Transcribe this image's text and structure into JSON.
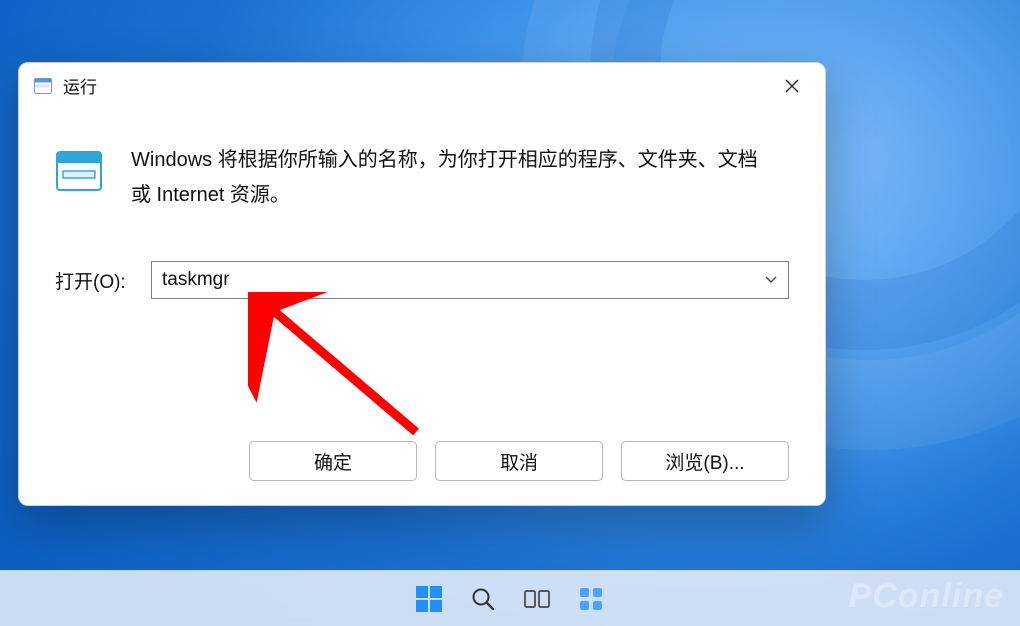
{
  "dialog": {
    "title": "运行",
    "description": "Windows 将根据你所输入的名称，为你打开相应的程序、文件夹、文档或 Internet 资源。",
    "open_label": "打开(O):",
    "input_value": "taskmgr",
    "buttons": {
      "ok": "确定",
      "cancel": "取消",
      "browse": "浏览(B)..."
    }
  },
  "icons": {
    "title_icon": "run-icon",
    "body_icon": "run-icon-large",
    "close": "close-icon",
    "dropdown": "chevron-down-icon"
  },
  "taskbar": {
    "start": "start-icon",
    "search": "search-icon"
  },
  "watermark": "PConline"
}
